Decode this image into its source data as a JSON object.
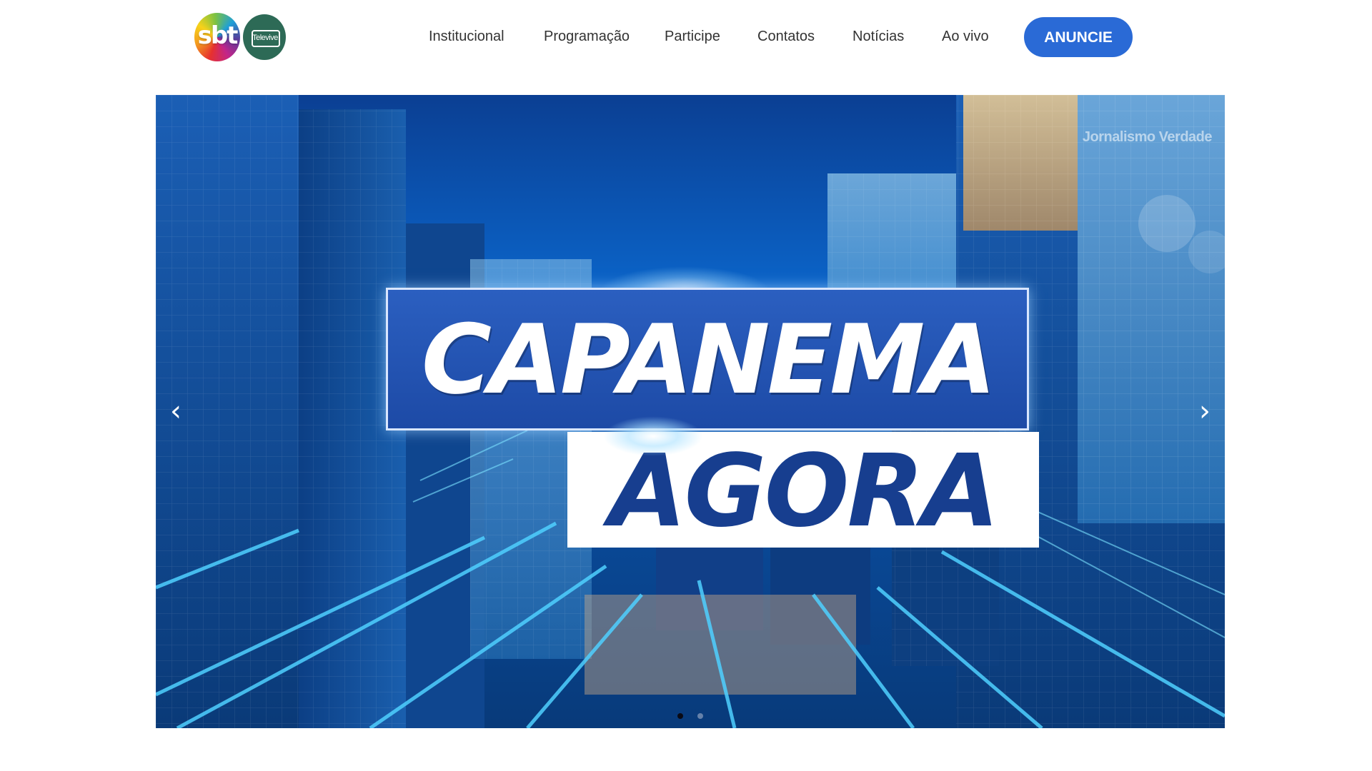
{
  "header": {
    "logos": [
      {
        "name": "sbt-logo",
        "text": "sbt"
      },
      {
        "name": "televive-logo",
        "text": "Televive"
      }
    ],
    "nav": [
      {
        "label": "Institucional"
      },
      {
        "label": "Programação"
      },
      {
        "label": "Participe"
      },
      {
        "label": "Contatos"
      },
      {
        "label": "Notícias"
      },
      {
        "label": "Ao vivo"
      }
    ],
    "cta_label": "ANUNCIE"
  },
  "banner": {
    "watermark": "Jornalismo Verdade",
    "title_line1": "CAPANEMA",
    "title_line2": "AGORA",
    "prev_icon": "chevron-left-icon",
    "next_icon": "chevron-right-icon",
    "prev_glyph": "‹",
    "next_glyph": "›",
    "slides_total": 2,
    "active_slide": 1
  },
  "colors": {
    "cta": "#2a6ad6",
    "nav_text": "#333333",
    "banner_blue": "#0b4fa3",
    "title_blue": "#173e8f"
  }
}
